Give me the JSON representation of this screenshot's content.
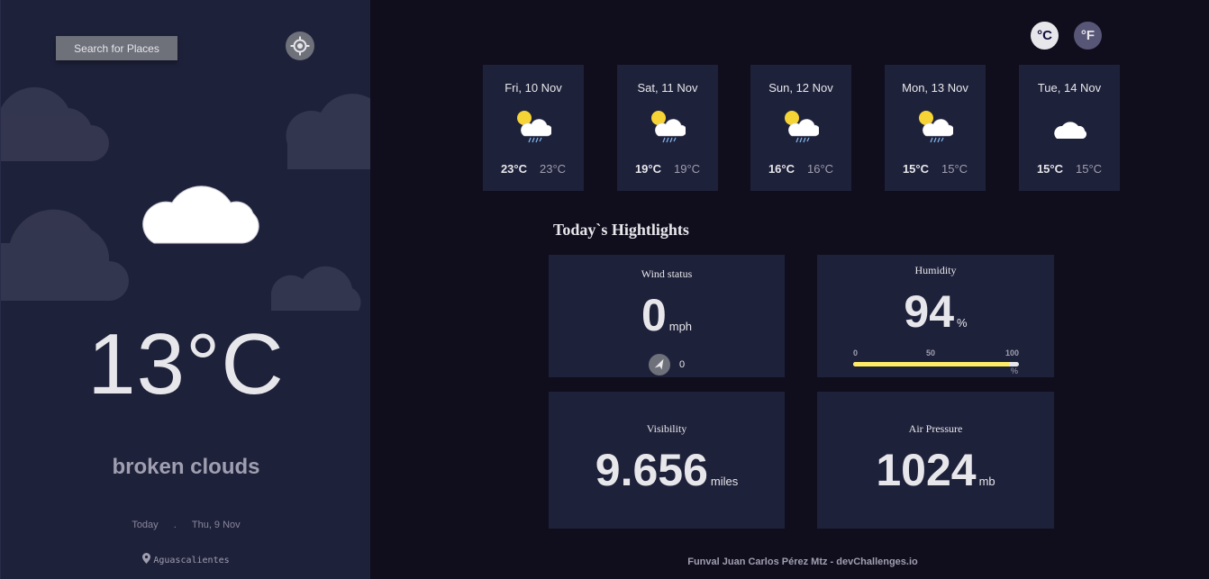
{
  "sidebar": {
    "search_label": "Search for Places",
    "locate_icon": "crosshair-icon",
    "current_icon": "cloud-icon",
    "temperature": "13°C",
    "description": "broken clouds",
    "today_label": "Today",
    "separator": ".",
    "date": "Thu, 9 Nov",
    "location": "Aguascalientes",
    "location_icon": "map-pin-icon"
  },
  "units": {
    "celsius": "°C",
    "fahrenheit": "°F"
  },
  "forecast": [
    {
      "date": "Fri, 10 Nov",
      "icon": "sun-cloud-rain-icon",
      "max": "23°C",
      "min": "23°C"
    },
    {
      "date": "Sat, 11 Nov",
      "icon": "sun-cloud-rain-icon",
      "max": "19°C",
      "min": "19°C"
    },
    {
      "date": "Sun, 12 Nov",
      "icon": "sun-cloud-rain-icon",
      "max": "16°C",
      "min": "16°C"
    },
    {
      "date": "Mon, 13 Nov",
      "icon": "sun-cloud-rain-icon",
      "max": "15°C",
      "min": "15°C"
    },
    {
      "date": "Tue, 14 Nov",
      "icon": "cloud-icon",
      "max": "15°C",
      "min": "15°C"
    }
  ],
  "highlights": {
    "title": "Today`s Hightlights",
    "wind": {
      "label": "Wind status",
      "value": "0",
      "unit": "mph",
      "direction": "0",
      "direction_icon": "navigation-arrow-icon"
    },
    "humidity": {
      "label": "Humidity",
      "value": "94",
      "unit": "%",
      "scale": [
        "0",
        "50",
        "100"
      ],
      "scale_unit": "%",
      "fill_percent": 94
    },
    "visibility": {
      "label": "Visibility",
      "value": "9.656",
      "unit": "miles"
    },
    "pressure": {
      "label": "Air Pressure",
      "value": "1024",
      "unit": "mb"
    }
  },
  "footer": {
    "text": "Funval Juan Carlos Pérez Mtz - devChallenges.io"
  },
  "colors": {
    "sidebar_bg": "#1e213a",
    "page_bg": "#100e1d",
    "accent_yellow": "#ffec65",
    "muted": "#a09fb1"
  }
}
